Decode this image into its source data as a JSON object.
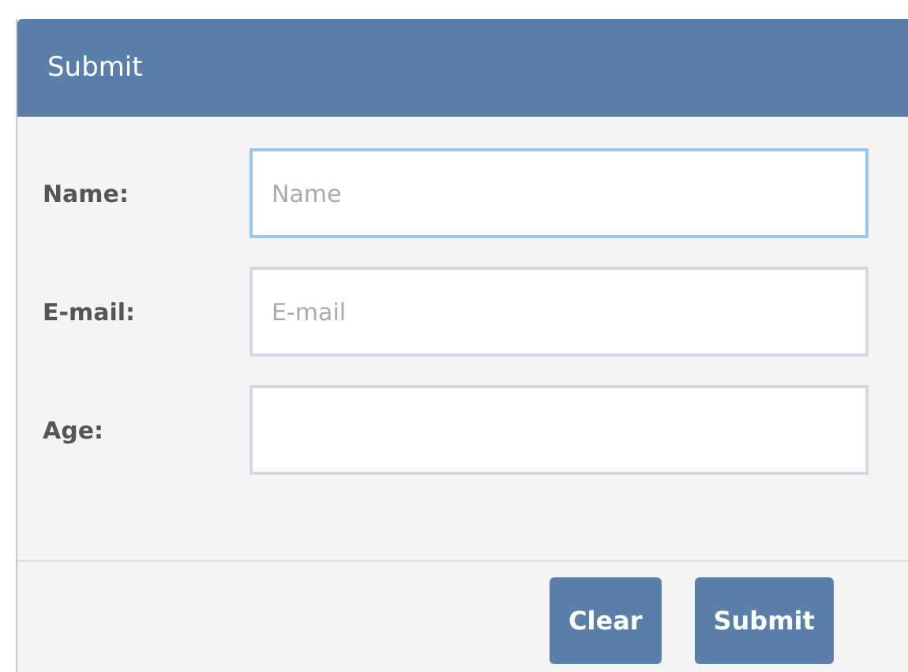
{
  "panel": {
    "title": "Submit"
  },
  "fields": [
    {
      "label": "Name:",
      "placeholder": "Name",
      "focused": true
    },
    {
      "label": "E-mail:",
      "placeholder": "E-mail",
      "focused": false
    },
    {
      "label": "Age:",
      "focused": false
    }
  ],
  "buttons": [
    "Clear",
    "Submit"
  ]
}
